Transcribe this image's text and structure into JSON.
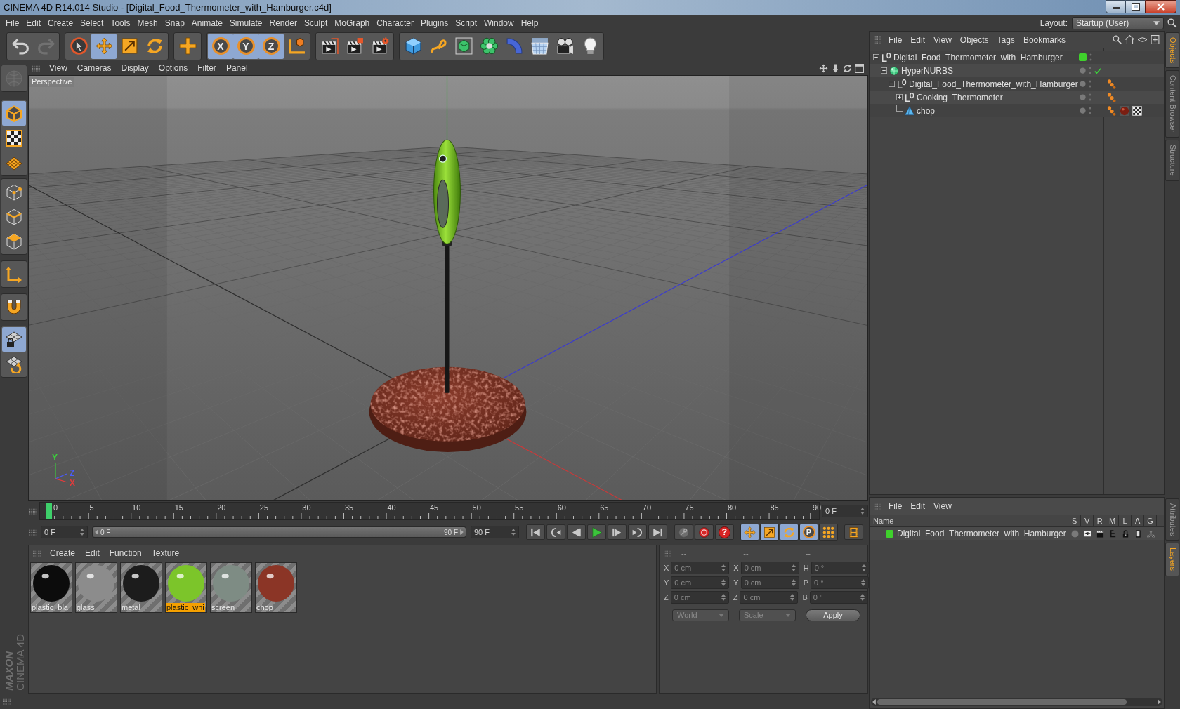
{
  "window": {
    "title": "CINEMA 4D R14.014 Studio - [Digital_Food_Thermometer_with_Hamburger.c4d]"
  },
  "menu_bar": [
    "File",
    "Edit",
    "Create",
    "Select",
    "Tools",
    "Mesh",
    "Snap",
    "Animate",
    "Simulate",
    "Render",
    "Sculpt",
    "MoGraph",
    "Character",
    "Plugins",
    "Script",
    "Window",
    "Help"
  ],
  "layout": {
    "label": "Layout:",
    "value": "Startup (User)"
  },
  "toolbar": [
    [
      {
        "kind": "undo",
        "disabled": false
      },
      {
        "kind": "redo",
        "disabled": true
      }
    ],
    [
      {
        "kind": "select",
        "selected": false
      },
      {
        "kind": "move",
        "selected": true
      },
      {
        "kind": "scale",
        "selected": false
      },
      {
        "kind": "rotate",
        "selected": false
      }
    ],
    [
      {
        "kind": "live",
        "selected": false
      }
    ],
    [
      {
        "kind": "axis",
        "label": "X",
        "selected": true
      },
      {
        "kind": "axis",
        "label": "Y",
        "selected": true
      },
      {
        "kind": "axis",
        "label": "Z",
        "selected": true
      },
      {
        "kind": "coords",
        "selected": false
      }
    ],
    [
      {
        "kind": "render_view"
      },
      {
        "kind": "render_picture"
      },
      {
        "kind": "render_settings"
      }
    ],
    [
      {
        "kind": "cube"
      },
      {
        "kind": "spline"
      },
      {
        "kind": "nurbs"
      },
      {
        "kind": "array"
      },
      {
        "kind": "deformer"
      },
      {
        "kind": "floor"
      },
      {
        "kind": "camera"
      },
      {
        "kind": "light"
      }
    ]
  ],
  "side_toolbar": [
    [
      {
        "kind": "make_editable",
        "disabled": true
      }
    ],
    [
      {
        "kind": "model",
        "selected": true
      },
      {
        "kind": "texture",
        "selected": false
      },
      {
        "kind": "workplane",
        "selected": false
      }
    ],
    [
      {
        "kind": "points",
        "selected": false
      },
      {
        "kind": "edges",
        "selected": false
      },
      {
        "kind": "polygons",
        "selected": false
      }
    ],
    [
      {
        "kind": "axis_mode",
        "selected": false
      }
    ],
    [
      {
        "kind": "magnet",
        "selected": false
      }
    ],
    [
      {
        "kind": "grid_lock",
        "selected": true
      },
      {
        "kind": "grid_rotate",
        "selected": false
      }
    ]
  ],
  "logo": {
    "brand": "MAXON",
    "product": "CINEMA 4D"
  },
  "viewport": {
    "menu": [
      "View",
      "Cameras",
      "Display",
      "Options",
      "Filter",
      "Panel"
    ],
    "camera": "Perspective",
    "axis_labels": [
      {
        "label": "Y",
        "color": "#3ccf3c"
      },
      {
        "label": "Z",
        "color": "#4a5cff"
      },
      {
        "label": "X",
        "color": "#e23c3c"
      }
    ]
  },
  "timeline": {
    "ticks": [
      "0",
      "5",
      "10",
      "15",
      "20",
      "25",
      "30",
      "35",
      "40",
      "45",
      "50",
      "55",
      "60",
      "65",
      "70",
      "75",
      "80",
      "85",
      "90"
    ],
    "level": 0,
    "frame": "0 F"
  },
  "playback": {
    "start": "0 F",
    "range": {
      "start": "0 F",
      "end": "90 F",
      "level": 1
    },
    "end": "90 F",
    "autokey_label": "?",
    "modes": [
      {
        "kind": "move",
        "selected": true
      },
      {
        "kind": "scale",
        "selected": true
      },
      {
        "kind": "rotate",
        "selected": true
      },
      {
        "kind": "param",
        "label": "P",
        "selected": true
      },
      {
        "kind": "point_level",
        "selected": false
      }
    ]
  },
  "materials": {
    "menu": [
      "Create",
      "Edit",
      "Function",
      "Texture"
    ],
    "items": [
      {
        "name": "plastic_bla",
        "color": "#0c0c0c",
        "selected": false
      },
      {
        "name": "glass",
        "color": "#8c8c8c",
        "selected": false
      },
      {
        "name": "metal",
        "color": "#1c1c1c",
        "selected": false
      },
      {
        "name": "plastic_whi",
        "color": "#7cc52a",
        "selected": true
      },
      {
        "name": "screen",
        "color": "#7e8c84",
        "selected": false
      },
      {
        "name": "chop",
        "color": "#8b3526",
        "selected": false
      }
    ]
  },
  "coordinates": {
    "headers": [
      "--",
      "--",
      "--"
    ],
    "rows": [
      {
        "axis": "X",
        "position": "0 cm",
        "size_axis": "X",
        "size": "0 cm",
        "rotation_axis": "H",
        "rotation": "0 °"
      },
      {
        "axis": "Y",
        "position": "0 cm",
        "size_axis": "Y",
        "size": "0 cm",
        "rotation_axis": "P",
        "rotation": "0 °"
      },
      {
        "axis": "Z",
        "position": "0 cm",
        "size_axis": "Z",
        "size": "0 cm",
        "rotation_axis": "B",
        "rotation": "0 °"
      }
    ],
    "dropdowns": [
      {
        "value": "World",
        "disabled": true
      },
      {
        "value": "Scale",
        "disabled": true
      }
    ],
    "apply": "Apply"
  },
  "object_manager": {
    "menu": [
      "File",
      "Edit",
      "View",
      "Objects",
      "Tags",
      "Bookmarks"
    ],
    "tree": [
      {
        "name": "Digital_Food_Thermometer_with_Hamburger",
        "kind": "null",
        "expanded": true,
        "color": "#3fd12c",
        "children": [
          {
            "name": "HyperNURBS",
            "kind": "generator",
            "expanded": true,
            "enabled": true,
            "children": [
              {
                "name": "Digital_Food_Thermometer_with_Hamburger",
                "kind": "null",
                "expanded": true,
                "tags": [
                  {
                    "kind": "phong"
                  }
                ],
                "children": [
                  {
                    "name": "Cooking_Thermometer",
                    "kind": "null",
                    "expanded": false,
                    "tags": [
                      {
                        "kind": "phong"
                      }
                    ]
                  },
                  {
                    "name": "chop",
                    "kind": "polygon",
                    "tags": [
                      {
                        "kind": "phong"
                      },
                      {
                        "kind": "material"
                      },
                      {
                        "kind": "texture"
                      }
                    ]
                  }
                ]
              }
            ]
          }
        ]
      }
    ]
  },
  "layers": {
    "menu": [
      "File",
      "Edit",
      "View"
    ],
    "columns": [
      "Name",
      "S",
      "V",
      "R",
      "M",
      "L",
      "A",
      "G"
    ],
    "rows": [
      {
        "name": "Digital_Food_Thermometer_with_Hamburger",
        "color": "#3fd12c"
      }
    ]
  },
  "side_tabs": {
    "top": [
      {
        "label": "Objects",
        "selected": true
      },
      {
        "label": "Content Browser",
        "selected": false
      },
      {
        "label": "Structure",
        "selected": false
      }
    ],
    "bottom": [
      {
        "label": "Attributes",
        "selected": false
      },
      {
        "label": "Layers",
        "selected": true
      }
    ]
  }
}
